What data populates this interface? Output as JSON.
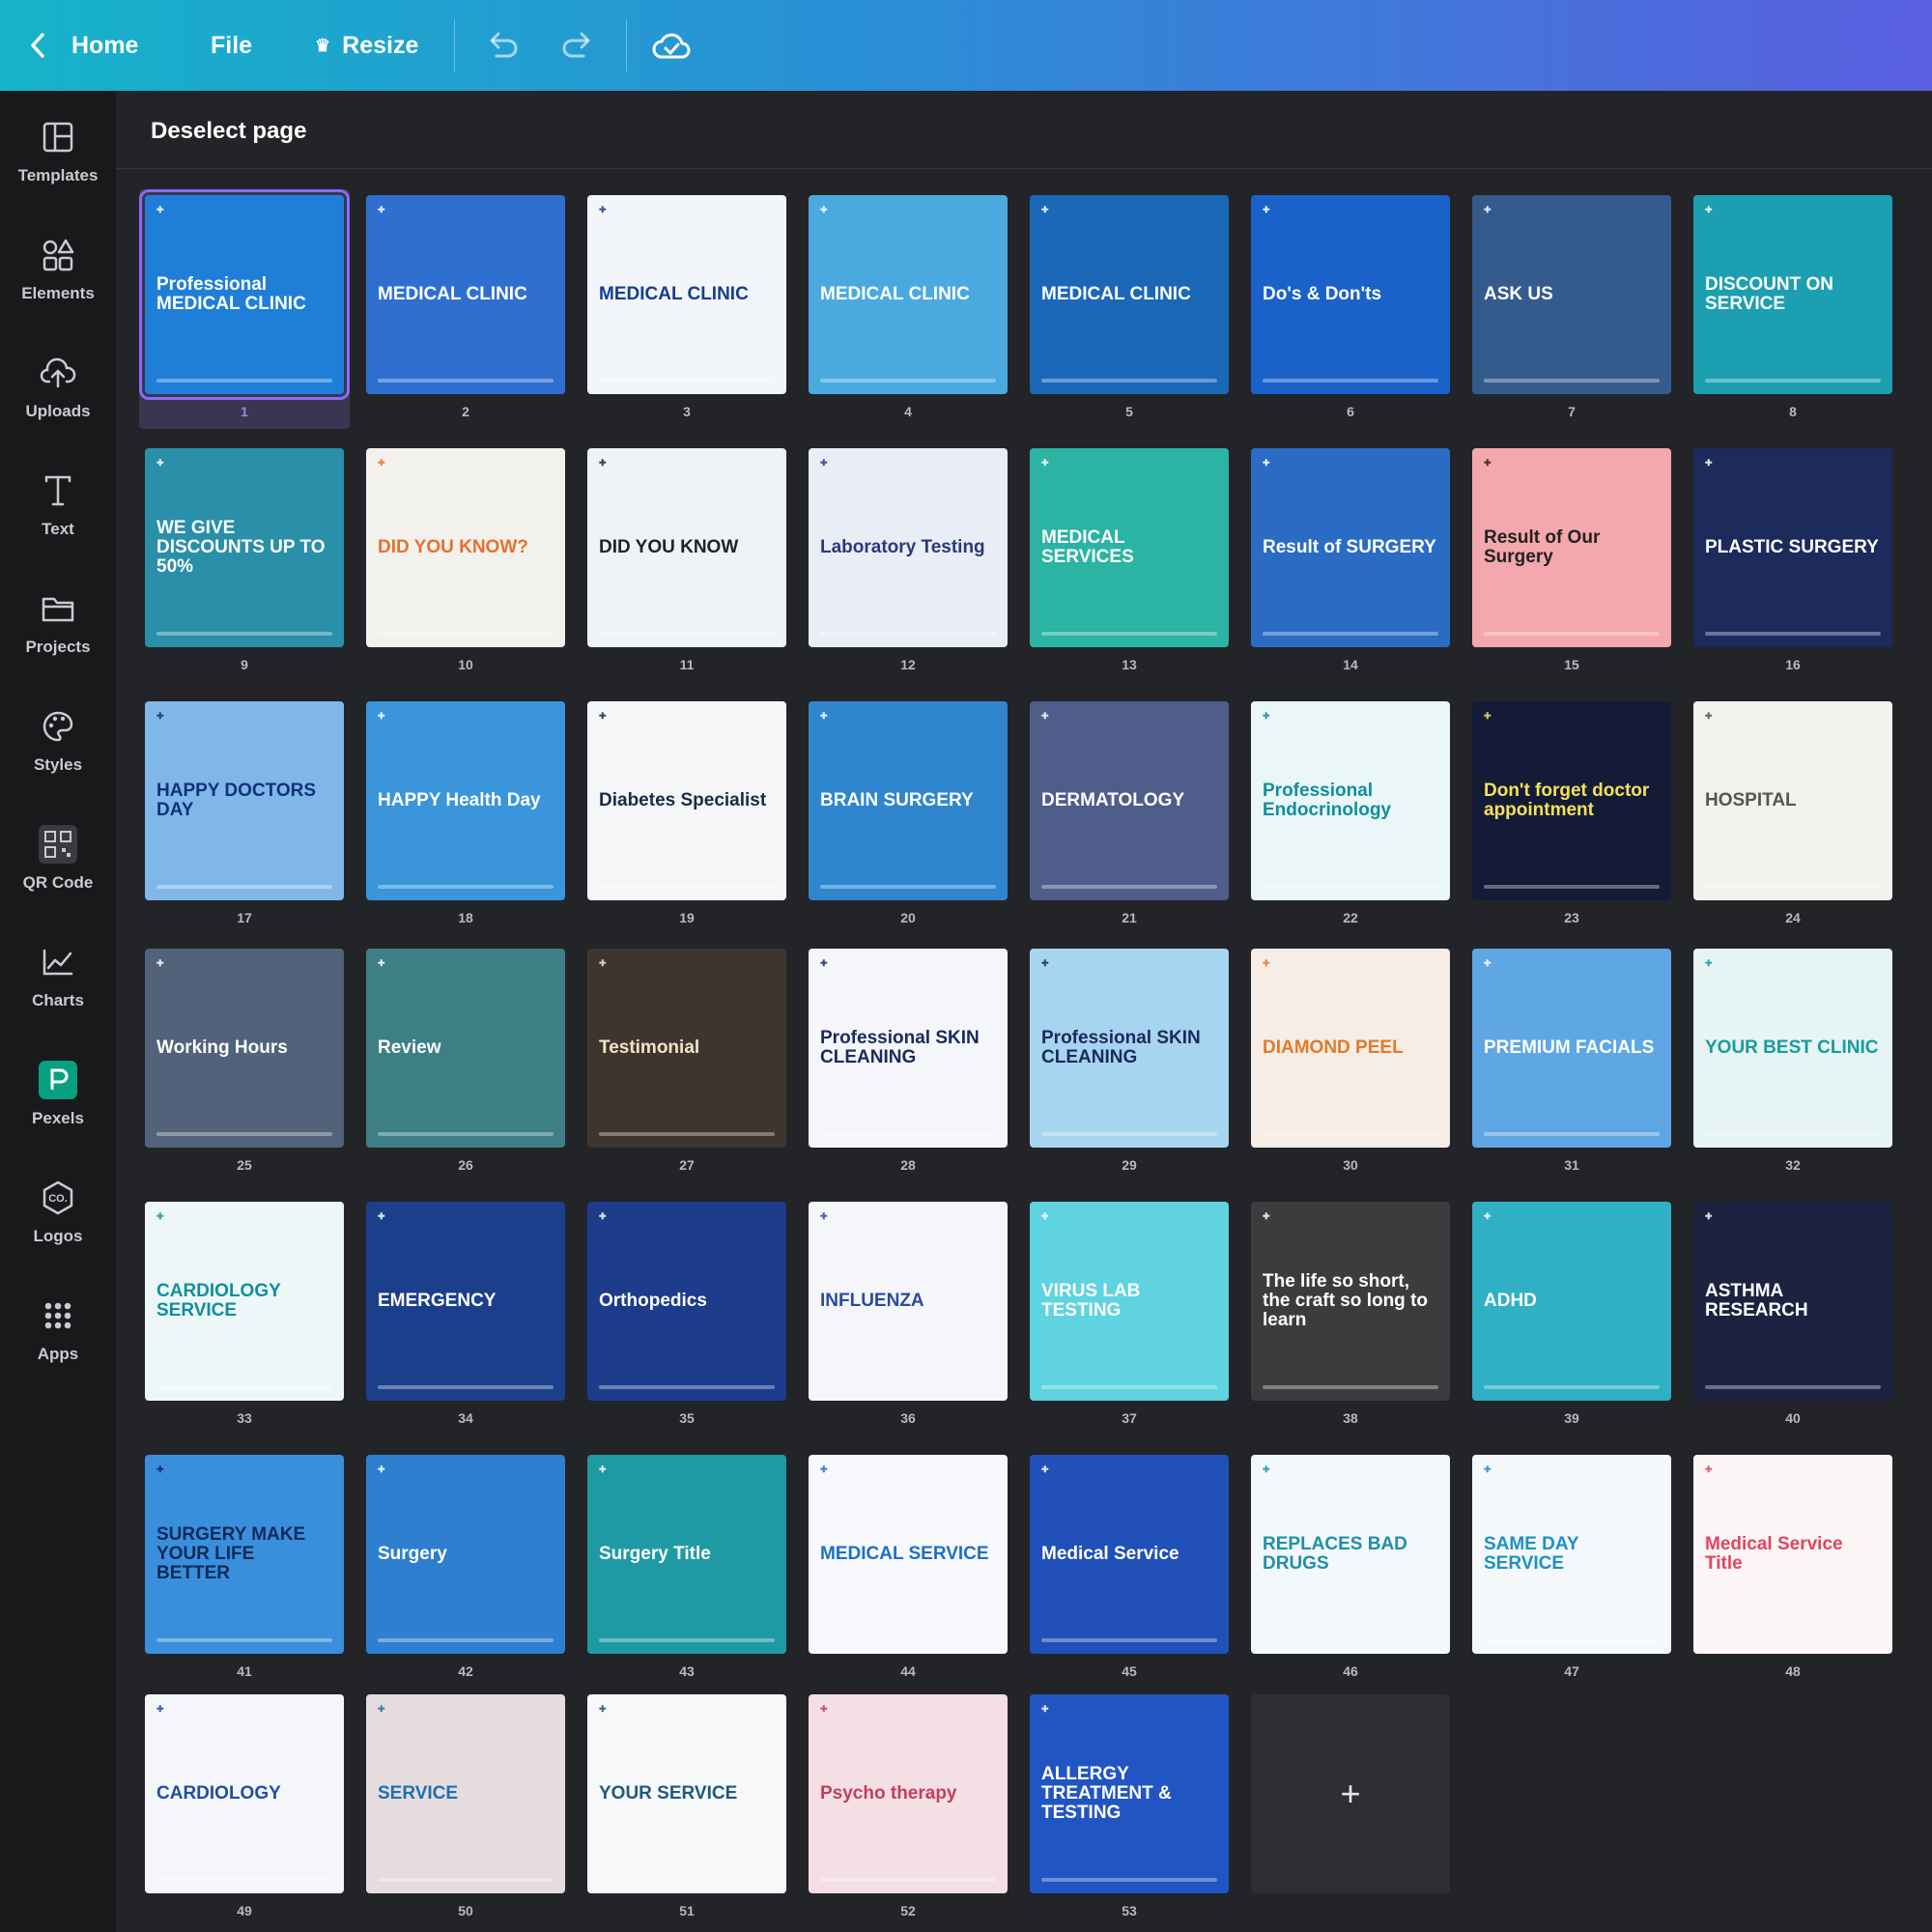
{
  "topbar": {
    "home_label": "Home",
    "file_label": "File",
    "resize_label": "Resize",
    "undo_icon": "undo-icon",
    "redo_icon": "redo-icon",
    "save_icon": "cloud-check-icon"
  },
  "sidebar": {
    "items": [
      {
        "label": "Templates",
        "icon": "templates-icon"
      },
      {
        "label": "Elements",
        "icon": "elements-icon"
      },
      {
        "label": "Uploads",
        "icon": "upload-icon"
      },
      {
        "label": "Text",
        "icon": "text-icon"
      },
      {
        "label": "Projects",
        "icon": "folder-icon"
      },
      {
        "label": "Styles",
        "icon": "palette-icon"
      },
      {
        "label": "QR Code",
        "icon": "qr-code-icon"
      },
      {
        "label": "Charts",
        "icon": "chart-icon"
      },
      {
        "label": "Pexels",
        "icon": "pexels-icon"
      },
      {
        "label": "Logos",
        "icon": "logos-icon"
      },
      {
        "label": "Apps",
        "icon": "apps-icon"
      }
    ]
  },
  "main": {
    "deselect_label": "Deselect page",
    "add_page_label": "+",
    "selected_page": 1,
    "pages": [
      {
        "num": "1",
        "title": "Professional MEDICAL CLINIC",
        "bg": "#1f7fd8",
        "fg": "#ffffff"
      },
      {
        "num": "2",
        "title": "MEDICAL CLINIC",
        "bg": "#2f6fd0",
        "fg": "#ffffff"
      },
      {
        "num": "3",
        "title": "MEDICAL CLINIC",
        "bg": "#f2f6fb",
        "fg": "#173d8f"
      },
      {
        "num": "4",
        "title": "MEDICAL CLINIC",
        "bg": "#4aa9df",
        "fg": "#ffffff"
      },
      {
        "num": "5",
        "title": "MEDICAL CLINIC",
        "bg": "#1b67b8",
        "fg": "#ffffff"
      },
      {
        "num": "6",
        "title": "Do's & Don'ts",
        "bg": "#1a62c9",
        "fg": "#ffffff"
      },
      {
        "num": "7",
        "title": "ASK US",
        "bg": "#355a8c",
        "fg": "#ffffff"
      },
      {
        "num": "8",
        "title": "DISCOUNT ON SERVICE",
        "bg": "#1c9fb0",
        "fg": "#ffffff"
      },
      {
        "num": "9",
        "title": "WE GIVE DISCOUNTS UP TO 50%",
        "bg": "#2a8fa8",
        "fg": "#ffffff"
      },
      {
        "num": "10",
        "title": "DID YOU KNOW?",
        "bg": "#f3f1ee",
        "fg": "#e8702a"
      },
      {
        "num": "11",
        "title": "DID YOU KNOW",
        "bg": "#eef3f7",
        "fg": "#222222"
      },
      {
        "num": "12",
        "title": "Laboratory Testing",
        "bg": "#e9edf6",
        "fg": "#283a78"
      },
      {
        "num": "13",
        "title": "MEDICAL SERVICES",
        "bg": "#2bb3a3",
        "fg": "#ffffff"
      },
      {
        "num": "14",
        "title": "Result of SURGERY",
        "bg": "#2a6cc4",
        "fg": "#ffffff"
      },
      {
        "num": "15",
        "title": "Result of Our Surgery",
        "bg": "#f4a7ad",
        "fg": "#222222"
      },
      {
        "num": "16",
        "title": "PLASTIC SURGERY",
        "bg": "#1c2a5c",
        "fg": "#ffffff"
      },
      {
        "num": "17",
        "title": "HAPPY DOCTORS DAY",
        "bg": "#7fb7e8",
        "fg": "#12307a"
      },
      {
        "num": "18",
        "title": "HAPPY Health Day",
        "bg": "#3a95da",
        "fg": "#ffffff"
      },
      {
        "num": "19",
        "title": "Diabetes Specialist",
        "bg": "#f4f6f8",
        "fg": "#1a2a4a"
      },
      {
        "num": "20",
        "title": "BRAIN SURGERY",
        "bg": "#2f86cf",
        "fg": "#ffffff"
      },
      {
        "num": "21",
        "title": "DERMATOLOGY",
        "bg": "#4e5d8a",
        "fg": "#ffffff"
      },
      {
        "num": "22",
        "title": "Professional Endocrinology",
        "bg": "#eaf6f8",
        "fg": "#0f8f9c"
      },
      {
        "num": "23",
        "title": "Don't forget doctor appointment",
        "bg": "#141b36",
        "fg": "#f5e15a"
      },
      {
        "num": "24",
        "title": "HOSPITAL",
        "bg": "#f4f2ef",
        "fg": "#555555"
      },
      {
        "num": "25",
        "title": "Working Hours",
        "bg": "#52627a",
        "fg": "#ffffff"
      },
      {
        "num": "26",
        "title": "Review",
        "bg": "#3e7f86",
        "fg": "#ffffff"
      },
      {
        "num": "27",
        "title": "Testimonial",
        "bg": "#3f352f",
        "fg": "#f3e3c6"
      },
      {
        "num": "28",
        "title": "Professional SKIN CLEANING",
        "bg": "#f4f6f9",
        "fg": "#1a2a5c"
      },
      {
        "num": "29",
        "title": "Professional SKIN CLEANING",
        "bg": "#a7d4ee",
        "fg": "#1a2a5c"
      },
      {
        "num": "30",
        "title": "DIAMOND PEEL",
        "bg": "#f6ede6",
        "fg": "#e07a2c"
      },
      {
        "num": "31",
        "title": "PREMIUM FACIALS",
        "bg": "#5fa7e4",
        "fg": "#ffffff"
      },
      {
        "num": "32",
        "title": "YOUR BEST CLINIC",
        "bg": "#e6f4f4",
        "fg": "#1a9b9b"
      },
      {
        "num": "33",
        "title": "CARDIOLOGY SERVICE",
        "bg": "#eef7f7",
        "fg": "#0f8f9c"
      },
      {
        "num": "34",
        "title": "EMERGENCY",
        "bg": "#1c3f8c",
        "fg": "#ffffff"
      },
      {
        "num": "35",
        "title": "Orthopedics",
        "bg": "#1e3c8c",
        "fg": "#ffffff"
      },
      {
        "num": "36",
        "title": "INFLUENZA",
        "bg": "#f4f6fa",
        "fg": "#2a4b9c"
      },
      {
        "num": "37",
        "title": "VIRUS LAB TESTING",
        "bg": "#5fd3e0",
        "fg": "#ffffff"
      },
      {
        "num": "38",
        "title": "The life so short, the craft so long to learn",
        "bg": "#3c3c3e",
        "fg": "#ffffff"
      },
      {
        "num": "39",
        "title": "ADHD",
        "bg": "#2fb0c4",
        "fg": "#ffffff"
      },
      {
        "num": "40",
        "title": "ASTHMA RESEARCH",
        "bg": "#1c2340",
        "fg": "#ffffff"
      },
      {
        "num": "41",
        "title": "SURGERY MAKE YOUR LIFE BETTER",
        "bg": "#3a8fdc",
        "fg": "#0e2a5a"
      },
      {
        "num": "42",
        "title": "Surgery",
        "bg": "#2f7fd0",
        "fg": "#ffffff"
      },
      {
        "num": "43",
        "title": "Surgery Title",
        "bg": "#1f9aa4",
        "fg": "#ffffff"
      },
      {
        "num": "44",
        "title": "MEDICAL SERVICE",
        "bg": "#f6f8fb",
        "fg": "#1f6fc4"
      },
      {
        "num": "45",
        "title": "Medical Service",
        "bg": "#2050b8",
        "fg": "#ffffff"
      },
      {
        "num": "46",
        "title": "REPLACES BAD DRUGS",
        "bg": "#f3f8fa",
        "fg": "#1f8fa8"
      },
      {
        "num": "47",
        "title": "SAME DAY SERVICE",
        "bg": "#f4f8fb",
        "fg": "#1f8fc4"
      },
      {
        "num": "48",
        "title": "Medical Service Title",
        "bg": "#fbf5f6",
        "fg": "#e0455e"
      },
      {
        "num": "49",
        "title": "CARDIOLOGY",
        "bg": "#f4f6fa",
        "fg": "#1f4fa0"
      },
      {
        "num": "50",
        "title": "SERVICE",
        "bg": "#e6dcde",
        "fg": "#1f6fb0"
      },
      {
        "num": "51",
        "title": "YOUR SERVICE",
        "bg": "#f6f8f9",
        "fg": "#1f5a7a"
      },
      {
        "num": "52",
        "title": "Psycho therapy",
        "bg": "#f3dfe4",
        "fg": "#c13d63"
      },
      {
        "num": "53",
        "title": "ALLERGY TREATMENT & TESTING",
        "bg": "#2255c4",
        "fg": "#ffffff"
      }
    ]
  }
}
